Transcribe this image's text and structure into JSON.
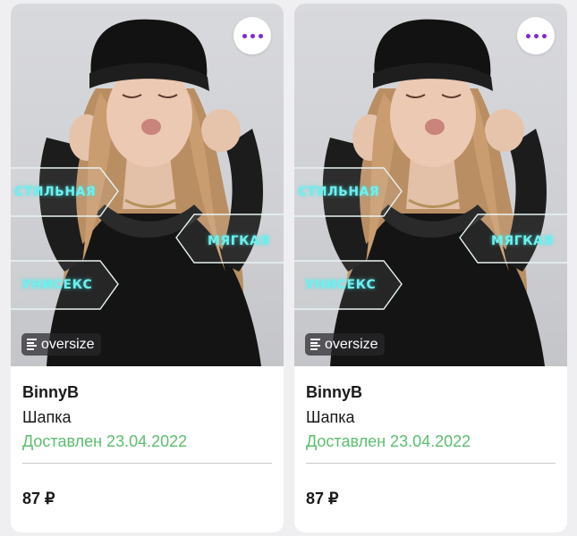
{
  "accent_color": "#7b2bc9",
  "status_color": "#5cbd6d",
  "cards": [
    {
      "image_tags": [
        "Стильная",
        "Мягкая",
        "Унисекс"
      ],
      "badge": {
        "icon": "text-lines-icon",
        "label": "oversize"
      },
      "more_icon": "more-dots-icon",
      "brand": "BinnyB",
      "product": "Шапка",
      "status": "Доставлен 23.04.2022",
      "price": "87 ₽"
    },
    {
      "image_tags": [
        "Стильная",
        "Мягкая",
        "Унисекс"
      ],
      "badge": {
        "icon": "text-lines-icon",
        "label": "oversize"
      },
      "more_icon": "more-dots-icon",
      "brand": "BinnyB",
      "product": "Шапка",
      "status": "Доставлен 23.04.2022",
      "price": "87 ₽"
    }
  ]
}
